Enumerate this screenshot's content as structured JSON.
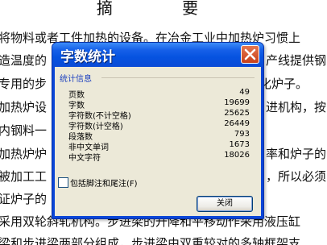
{
  "document": {
    "title": "摘 要",
    "lines": [
      "将物料或者工件加热的设备。在冶金工业中加热炉习惯上",
      "造温度的",
      "专用的步",
      "加热炉设",
      "内钢料一",
      "加热炉炉",
      "被加工工",
      "证炉子的",
      "采用双轮斜轧机构。步进梁的升降和平移动作采用液压缸",
      "梁和步进梁两部分组成，步进梁由双重较对的多轴框架支"
    ],
    "right_fragments": [
      "产线提供钢",
      "化炉子。",
      "进机构，按",
      "率和炉子的",
      "，所以必须"
    ]
  },
  "dialog": {
    "title": "字数统计",
    "group_label": "统计信息",
    "stats": [
      {
        "label": "页数",
        "value": "49"
      },
      {
        "label": "字数",
        "value": "19699"
      },
      {
        "label": "字符数(不计空格)",
        "value": "25625"
      },
      {
        "label": "字符数(计空格)",
        "value": "26449"
      },
      {
        "label": "段落数",
        "value": "793"
      },
      {
        "label": "非中文单词",
        "value": "1673"
      },
      {
        "label": "中文字符",
        "value": "18026"
      }
    ],
    "checkbox_label": "包括脚注和尾注(F)",
    "checkbox_checked": false,
    "close_button_label": "关闭",
    "close_icon": "close-x-icon"
  }
}
